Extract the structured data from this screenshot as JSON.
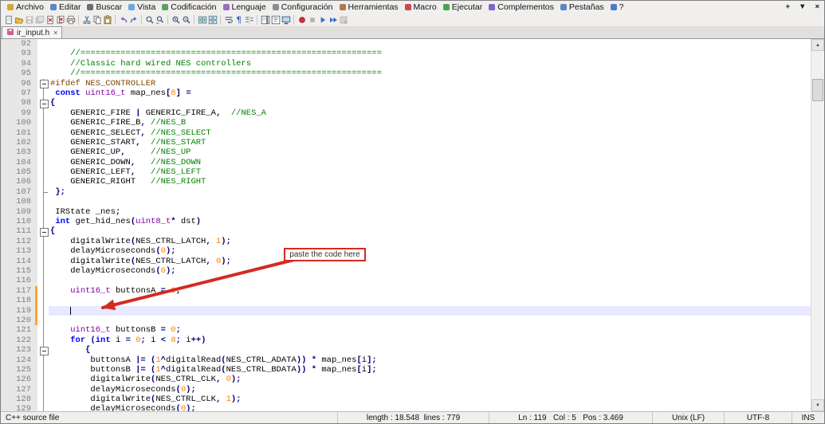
{
  "window": {
    "controls": [
      "+",
      "▼",
      "×"
    ]
  },
  "menubar": {
    "items": [
      {
        "label": "Archivo",
        "icon": "file-menu-icon",
        "color": "#d9a43b"
      },
      {
        "label": "Editar",
        "icon": "edit-menu-icon",
        "color": "#5b87c5"
      },
      {
        "label": "Buscar",
        "icon": "search-menu-icon",
        "color": "#6d6d6d"
      },
      {
        "label": "Vista",
        "icon": "view-menu-icon",
        "color": "#6fa8dc"
      },
      {
        "label": "Codificación",
        "icon": "encoding-menu-icon",
        "color": "#5fa05f"
      },
      {
        "label": "Lenguaje",
        "icon": "language-menu-icon",
        "color": "#9b6bc5"
      },
      {
        "label": "Configuración",
        "icon": "settings-menu-icon",
        "color": "#8d8d8d"
      },
      {
        "label": "Herramientas",
        "icon": "tools-menu-icon",
        "color": "#b5754a"
      },
      {
        "label": "Macro",
        "icon": "macro-menu-icon",
        "color": "#c54a4a"
      },
      {
        "label": "Ejecutar",
        "icon": "run-menu-icon",
        "color": "#4aa34a"
      },
      {
        "label": "Complementos",
        "icon": "plugins-menu-icon",
        "color": "#7b68c8"
      },
      {
        "label": "Pestañas",
        "icon": "tabs-menu-icon",
        "color": "#5b87c5"
      },
      {
        "label": "?",
        "icon": "help-menu-icon",
        "color": "#4a7bc5"
      }
    ]
  },
  "toolbar": {
    "buttons": [
      {
        "name": "new-file"
      },
      {
        "name": "open-file"
      },
      {
        "name": "save-file",
        "disabled": true
      },
      {
        "name": "save-all",
        "disabled": true
      },
      {
        "name": "close-file"
      },
      {
        "name": "close-all"
      },
      {
        "name": "print"
      },
      {
        "sep": true
      },
      {
        "name": "cut"
      },
      {
        "name": "copy"
      },
      {
        "name": "paste"
      },
      {
        "sep": true
      },
      {
        "name": "undo"
      },
      {
        "name": "redo"
      },
      {
        "sep": true
      },
      {
        "name": "find"
      },
      {
        "name": "replace"
      },
      {
        "sep": true
      },
      {
        "name": "zoom-in"
      },
      {
        "name": "zoom-out"
      },
      {
        "sep": true
      },
      {
        "name": "sync-vertical-scroll"
      },
      {
        "name": "sync-horizontal-scroll"
      },
      {
        "sep": true
      },
      {
        "name": "word-wrap"
      },
      {
        "name": "show-all-characters"
      },
      {
        "name": "indent-guides"
      },
      {
        "sep": true
      },
      {
        "name": "document-map"
      },
      {
        "name": "function-list"
      },
      {
        "name": "monitor"
      },
      {
        "sep": true
      },
      {
        "name": "record-macro"
      },
      {
        "name": "stop-macro",
        "disabled": true
      },
      {
        "name": "play-macro"
      },
      {
        "name": "run-macro-multiple"
      },
      {
        "name": "save-macro",
        "disabled": true
      }
    ]
  },
  "tabs": [
    {
      "label": "ir_input.h",
      "active": true
    }
  ],
  "palette": {
    "comment": "#008000",
    "number": "#ff8000",
    "keyword": "#0000ff",
    "operator": "#000080",
    "preprocessor": "#804000",
    "type": "#8000a0",
    "current_line": "#e8e8ff",
    "changed_marker": "#ffa22e",
    "annotation": "#d42a22"
  },
  "annotation": {
    "label": "paste the code here"
  },
  "statusbar": {
    "doc_type": "C++ source file",
    "length_lines": "length : 18.548  lines : 779",
    "position": "Ln : 119   Col : 5   Pos : 3.469",
    "eol": "Unix (LF)",
    "encoding": "UTF-8",
    "mode": "INS"
  },
  "editor": {
    "caret": {
      "line": 119,
      "col": 5
    },
    "lines": [
      {
        "n": 92,
        "f": "",
        "tk": []
      },
      {
        "n": 93,
        "f": "",
        "tk": [
          {
            "t": "    ",
            "c": "p"
          },
          {
            "t": "//============================================================",
            "c": "c"
          }
        ]
      },
      {
        "n": 94,
        "f": "",
        "tk": [
          {
            "t": "    ",
            "c": "p"
          },
          {
            "t": "//Classic hard wired NES controllers",
            "c": "c"
          }
        ]
      },
      {
        "n": 95,
        "f": "",
        "tk": [
          {
            "t": "    ",
            "c": "p"
          },
          {
            "t": "//============================================================",
            "c": "c"
          }
        ]
      },
      {
        "n": 96,
        "f": "start",
        "tk": [
          {
            "t": "#ifdef NES_CONTROLLER",
            "c": "d"
          }
        ]
      },
      {
        "n": 97,
        "f": "line",
        "tk": [
          {
            "t": " ",
            "c": "p"
          },
          {
            "t": "const",
            "c": "k"
          },
          {
            "t": " ",
            "c": "p"
          },
          {
            "t": "uint16_t",
            "c": "t"
          },
          {
            "t": " map_nes",
            "c": "p"
          },
          {
            "t": "[",
            "c": "o"
          },
          {
            "t": "8",
            "c": "n"
          },
          {
            "t": "]",
            "c": "o"
          },
          {
            "t": " ",
            "c": "p"
          },
          {
            "t": "=",
            "c": "o"
          }
        ]
      },
      {
        "n": 98,
        "f": "start",
        "tk": [
          {
            "t": "{",
            "c": "o"
          }
        ]
      },
      {
        "n": 99,
        "f": "line",
        "tk": [
          {
            "t": "    GENERIC_FIRE ",
            "c": "p"
          },
          {
            "t": "|",
            "c": "o"
          },
          {
            "t": " GENERIC_FIRE_A",
            "c": "p"
          },
          {
            "t": ",",
            "c": "o"
          },
          {
            "t": "  ",
            "c": "p"
          },
          {
            "t": "//NES_A",
            "c": "c"
          }
        ]
      },
      {
        "n": 100,
        "f": "line",
        "tk": [
          {
            "t": "    GENERIC_FIRE_B",
            "c": "p"
          },
          {
            "t": ",",
            "c": "o"
          },
          {
            "t": " ",
            "c": "p"
          },
          {
            "t": "//NES_B",
            "c": "c"
          }
        ]
      },
      {
        "n": 101,
        "f": "line",
        "tk": [
          {
            "t": "    GENERIC_SELECT",
            "c": "p"
          },
          {
            "t": ",",
            "c": "o"
          },
          {
            "t": " ",
            "c": "p"
          },
          {
            "t": "//NES_SELECT",
            "c": "c"
          }
        ]
      },
      {
        "n": 102,
        "f": "line",
        "tk": [
          {
            "t": "    GENERIC_START",
            "c": "p"
          },
          {
            "t": ",",
            "c": "o"
          },
          {
            "t": "  ",
            "c": "p"
          },
          {
            "t": "//NES_START",
            "c": "c"
          }
        ]
      },
      {
        "n": 103,
        "f": "line",
        "tk": [
          {
            "t": "    GENERIC_UP",
            "c": "p"
          },
          {
            "t": ",",
            "c": "o"
          },
          {
            "t": "     ",
            "c": "p"
          },
          {
            "t": "//NES_UP",
            "c": "c"
          }
        ]
      },
      {
        "n": 104,
        "f": "line",
        "tk": [
          {
            "t": "    GENERIC_DOWN",
            "c": "p"
          },
          {
            "t": ",",
            "c": "o"
          },
          {
            "t": "   ",
            "c": "p"
          },
          {
            "t": "//NES_DOWN",
            "c": "c"
          }
        ]
      },
      {
        "n": 105,
        "f": "line",
        "tk": [
          {
            "t": "    GENERIC_LEFT",
            "c": "p"
          },
          {
            "t": ",",
            "c": "o"
          },
          {
            "t": "   ",
            "c": "p"
          },
          {
            "t": "//NES_LEFT",
            "c": "c"
          }
        ]
      },
      {
        "n": 106,
        "f": "line",
        "tk": [
          {
            "t": "    GENERIC_RIGHT   ",
            "c": "p"
          },
          {
            "t": "//NES_RIGHT",
            "c": "c"
          }
        ]
      },
      {
        "n": 107,
        "f": "end",
        "tk": [
          {
            "t": " ",
            "c": "p"
          },
          {
            "t": "};",
            "c": "o"
          }
        ]
      },
      {
        "n": 108,
        "f": "line",
        "tk": []
      },
      {
        "n": 109,
        "f": "line",
        "tk": [
          {
            "t": " IRState _nes",
            "c": "p"
          },
          {
            "t": ";",
            "c": "o"
          }
        ]
      },
      {
        "n": 110,
        "f": "line",
        "tk": [
          {
            "t": " ",
            "c": "p"
          },
          {
            "t": "int",
            "c": "k"
          },
          {
            "t": " get_hid_nes",
            "c": "p"
          },
          {
            "t": "(",
            "c": "o"
          },
          {
            "t": "uint8_t",
            "c": "t"
          },
          {
            "t": "*",
            "c": "o"
          },
          {
            "t": " dst",
            "c": "p"
          },
          {
            "t": ")",
            "c": "o"
          }
        ]
      },
      {
        "n": 111,
        "f": "start",
        "tk": [
          {
            "t": "{",
            "c": "o"
          }
        ]
      },
      {
        "n": 112,
        "f": "line",
        "tk": [
          {
            "t": "    digitalWrite",
            "c": "p"
          },
          {
            "t": "(",
            "c": "o"
          },
          {
            "t": "NES_CTRL_LATCH",
            "c": "p"
          },
          {
            "t": ",",
            "c": "o"
          },
          {
            "t": " ",
            "c": "p"
          },
          {
            "t": "1",
            "c": "n"
          },
          {
            "t": ");",
            "c": "o"
          }
        ]
      },
      {
        "n": 113,
        "f": "line",
        "tk": [
          {
            "t": "    delayMicroseconds",
            "c": "p"
          },
          {
            "t": "(",
            "c": "o"
          },
          {
            "t": "0",
            "c": "n"
          },
          {
            "t": ");",
            "c": "o"
          }
        ]
      },
      {
        "n": 114,
        "f": "line",
        "tk": [
          {
            "t": "    digitalWrite",
            "c": "p"
          },
          {
            "t": "(",
            "c": "o"
          },
          {
            "t": "NES_CTRL_LATCH",
            "c": "p"
          },
          {
            "t": ",",
            "c": "o"
          },
          {
            "t": " ",
            "c": "p"
          },
          {
            "t": "0",
            "c": "n"
          },
          {
            "t": ");",
            "c": "o"
          }
        ]
      },
      {
        "n": 115,
        "f": "line",
        "tk": [
          {
            "t": "    delayMicroseconds",
            "c": "p"
          },
          {
            "t": "(",
            "c": "o"
          },
          {
            "t": "0",
            "c": "n"
          },
          {
            "t": ");",
            "c": "o"
          }
        ]
      },
      {
        "n": 116,
        "f": "line",
        "tk": []
      },
      {
        "n": 117,
        "f": "line",
        "m": true,
        "tk": [
          {
            "t": "    ",
            "c": "p"
          },
          {
            "t": "uint16_t",
            "c": "t"
          },
          {
            "t": " buttonsA ",
            "c": "p"
          },
          {
            "t": "=",
            "c": "o"
          },
          {
            "t": " ",
            "c": "p"
          },
          {
            "t": "0",
            "c": "n"
          },
          {
            "t": ";",
            "c": "o"
          }
        ]
      },
      {
        "n": 118,
        "f": "line",
        "m": true,
        "tk": []
      },
      {
        "n": 119,
        "f": "line",
        "m": true,
        "cur": true,
        "tk": []
      },
      {
        "n": 120,
        "f": "line",
        "m": true,
        "tk": []
      },
      {
        "n": 121,
        "f": "line",
        "tk": [
          {
            "t": "    ",
            "c": "p"
          },
          {
            "t": "uint16_t",
            "c": "t"
          },
          {
            "t": " buttonsB ",
            "c": "p"
          },
          {
            "t": "=",
            "c": "o"
          },
          {
            "t": " ",
            "c": "p"
          },
          {
            "t": "0",
            "c": "n"
          },
          {
            "t": ";",
            "c": "o"
          }
        ]
      },
      {
        "n": 122,
        "f": "line",
        "tk": [
          {
            "t": "    ",
            "c": "p"
          },
          {
            "t": "for",
            "c": "k"
          },
          {
            "t": " ",
            "c": "p"
          },
          {
            "t": "(",
            "c": "o"
          },
          {
            "t": "int",
            "c": "k"
          },
          {
            "t": " i ",
            "c": "p"
          },
          {
            "t": "=",
            "c": "o"
          },
          {
            "t": " ",
            "c": "p"
          },
          {
            "t": "0",
            "c": "n"
          },
          {
            "t": ";",
            "c": "o"
          },
          {
            "t": " i ",
            "c": "p"
          },
          {
            "t": "<",
            "c": "o"
          },
          {
            "t": " ",
            "c": "p"
          },
          {
            "t": "8",
            "c": "n"
          },
          {
            "t": ";",
            "c": "o"
          },
          {
            "t": " i",
            "c": "p"
          },
          {
            "t": "++)",
            "c": "o"
          }
        ]
      },
      {
        "n": 123,
        "f": "start",
        "tk": [
          {
            "t": "       ",
            "c": "p"
          },
          {
            "t": "{",
            "c": "o"
          }
        ]
      },
      {
        "n": 124,
        "f": "line",
        "tk": [
          {
            "t": "        buttonsA ",
            "c": "p"
          },
          {
            "t": "|=",
            "c": "o"
          },
          {
            "t": " ",
            "c": "p"
          },
          {
            "t": "(",
            "c": "o"
          },
          {
            "t": "1",
            "c": "n"
          },
          {
            "t": "^",
            "c": "o"
          },
          {
            "t": "digitalRead",
            "c": "p"
          },
          {
            "t": "(",
            "c": "o"
          },
          {
            "t": "NES_CTRL_ADATA",
            "c": "p"
          },
          {
            "t": "))",
            "c": "o"
          },
          {
            "t": " ",
            "c": "p"
          },
          {
            "t": "*",
            "c": "o"
          },
          {
            "t": " map_nes",
            "c": "p"
          },
          {
            "t": "[",
            "c": "o"
          },
          {
            "t": "i",
            "c": "p"
          },
          {
            "t": "];",
            "c": "o"
          }
        ]
      },
      {
        "n": 125,
        "f": "line",
        "tk": [
          {
            "t": "        buttonsB ",
            "c": "p"
          },
          {
            "t": "|=",
            "c": "o"
          },
          {
            "t": " ",
            "c": "p"
          },
          {
            "t": "(",
            "c": "o"
          },
          {
            "t": "1",
            "c": "n"
          },
          {
            "t": "^",
            "c": "o"
          },
          {
            "t": "digitalRead",
            "c": "p"
          },
          {
            "t": "(",
            "c": "o"
          },
          {
            "t": "NES_CTRL_BDATA",
            "c": "p"
          },
          {
            "t": "))",
            "c": "o"
          },
          {
            "t": " ",
            "c": "p"
          },
          {
            "t": "*",
            "c": "o"
          },
          {
            "t": " map_nes",
            "c": "p"
          },
          {
            "t": "[",
            "c": "o"
          },
          {
            "t": "i",
            "c": "p"
          },
          {
            "t": "];",
            "c": "o"
          }
        ]
      },
      {
        "n": 126,
        "f": "line",
        "tk": [
          {
            "t": "        digitalWrite",
            "c": "p"
          },
          {
            "t": "(",
            "c": "o"
          },
          {
            "t": "NES_CTRL_CLK",
            "c": "p"
          },
          {
            "t": ",",
            "c": "o"
          },
          {
            "t": " ",
            "c": "p"
          },
          {
            "t": "0",
            "c": "n"
          },
          {
            "t": ");",
            "c": "o"
          }
        ]
      },
      {
        "n": 127,
        "f": "line",
        "tk": [
          {
            "t": "        delayMicroseconds",
            "c": "p"
          },
          {
            "t": "(",
            "c": "o"
          },
          {
            "t": "0",
            "c": "n"
          },
          {
            "t": ");",
            "c": "o"
          }
        ]
      },
      {
        "n": 128,
        "f": "line",
        "tk": [
          {
            "t": "        digitalWrite",
            "c": "p"
          },
          {
            "t": "(",
            "c": "o"
          },
          {
            "t": "NES_CTRL_CLK",
            "c": "p"
          },
          {
            "t": ",",
            "c": "o"
          },
          {
            "t": " ",
            "c": "p"
          },
          {
            "t": "1",
            "c": "n"
          },
          {
            "t": ");",
            "c": "o"
          }
        ]
      },
      {
        "n": 129,
        "f": "line",
        "tk": [
          {
            "t": "        delayMicroseconds",
            "c": "p"
          },
          {
            "t": "(",
            "c": "o"
          },
          {
            "t": "0",
            "c": "n"
          },
          {
            "t": ");",
            "c": "o"
          }
        ]
      }
    ]
  }
}
